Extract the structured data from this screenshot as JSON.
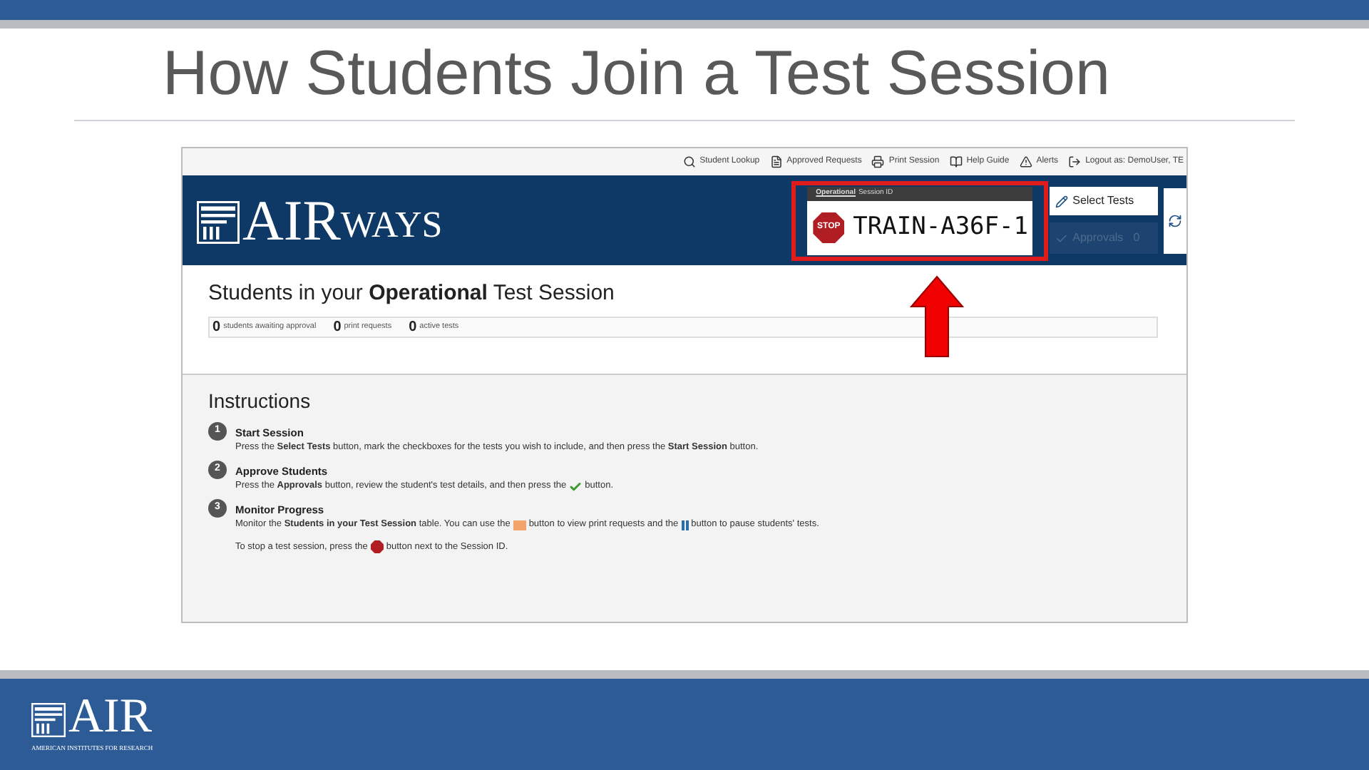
{
  "slide": {
    "title": "How Students Join a Test Session"
  },
  "app": {
    "toolbar": [
      {
        "kind": "search",
        "label": "Student Lookup"
      },
      {
        "kind": "doc",
        "label": "Approved Requests"
      },
      {
        "kind": "print",
        "label": "Print Session"
      },
      {
        "kind": "book",
        "label": "Help Guide"
      },
      {
        "kind": "alert",
        "label": "Alerts"
      },
      {
        "kind": "logout",
        "label": "Logout as: DemoUser, TE"
      }
    ],
    "logo": {
      "main": "AIR",
      "sub": "WAYS"
    },
    "session": {
      "label_strong": "Operational",
      "label_rest": "Session ID",
      "stop": "STOP",
      "id": "TRAIN-A36F-1",
      "highlighted": true
    },
    "select_tests": {
      "label": "Select Tests"
    },
    "approvals": {
      "label": "Approvals",
      "count": "0",
      "disabled": true
    },
    "heading": "Students in your **Operational** Test Session",
    "counts": [
      {
        "value": "0",
        "label": "students awaiting approval"
      },
      {
        "value": "0",
        "label": "print requests"
      },
      {
        "value": "0",
        "label": "active tests"
      }
    ],
    "instructions": {
      "title": "Instructions",
      "steps": [
        {
          "number": "1",
          "title": "Start Session",
          "lines": [
            [
              {
                "kind": "text",
                "text": "Press the **Select Tests** button, mark the checkboxes for the tests you wish to include, and then press the **Start Session** button."
              }
            ]
          ]
        },
        {
          "number": "2",
          "title": "Approve Students",
          "lines": [
            [
              {
                "kind": "text",
                "text": "Press the **Approvals** button, review the student's test details, and then press the"
              },
              {
                "kind": "check"
              },
              {
                "kind": "text",
                "text": "button."
              }
            ]
          ]
        },
        {
          "number": "3",
          "title": "Monitor Progress",
          "lines": [
            [
              {
                "kind": "text",
                "text": "Monitor the **Students in your Test Session** table. You can use the"
              },
              {
                "kind": "print"
              },
              {
                "kind": "text",
                "text": "button to view print requests and the"
              },
              {
                "kind": "pause"
              },
              {
                "kind": "text",
                "text": "button to pause students' tests."
              }
            ],
            [
              {
                "kind": "text",
                "text": "To stop a test session, press the"
              },
              {
                "kind": "stop"
              },
              {
                "kind": "text",
                "text": "button next to the Session ID."
              }
            ]
          ]
        }
      ]
    }
  },
  "footer": {
    "logo": "AIR",
    "tagline": "AMERICAN INSTITUTES FOR RESEARCH"
  }
}
